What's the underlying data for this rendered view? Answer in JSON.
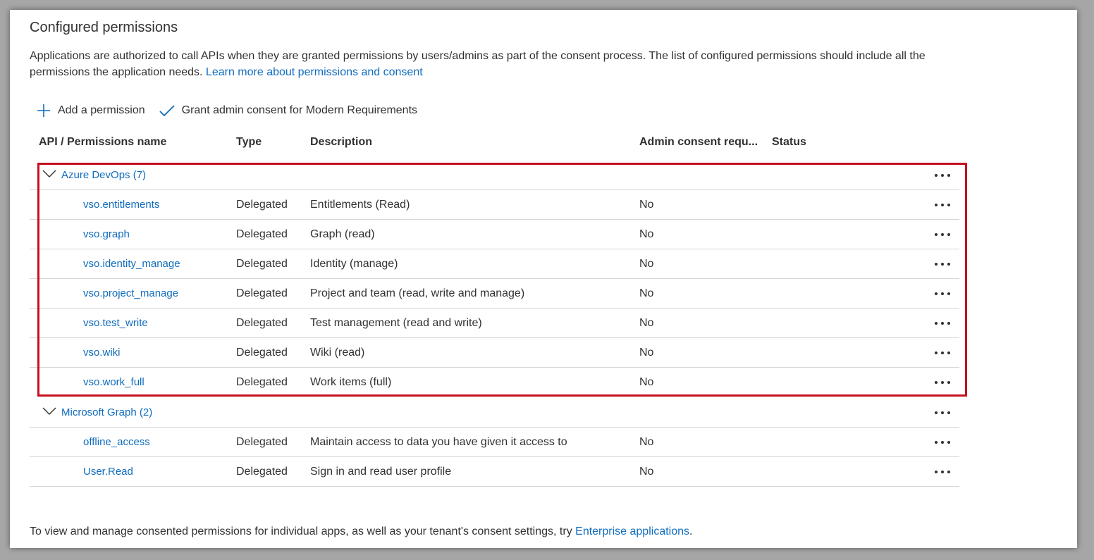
{
  "page": {
    "heading": "Configured permissions",
    "description": "Applications are authorized to call APIs when they are granted permissions by users/admins as part of the consent process. The list of configured permissions should include all the permissions the application needs.",
    "learn_more_link": "Learn more about permissions and consent"
  },
  "toolbar": {
    "add_permission": "Add a permission",
    "grant_consent": "Grant admin consent for Modern Requirements"
  },
  "columns": {
    "api_name": "API / Permissions name",
    "type": "Type",
    "description": "Description",
    "admin_consent": "Admin consent requ...",
    "status": "Status"
  },
  "groups": [
    {
      "label": "Azure DevOps (7)",
      "highlighted": true,
      "permissions": [
        {
          "name": "vso.entitlements",
          "type": "Delegated",
          "description": "Entitlements (Read)",
          "admin": "No"
        },
        {
          "name": "vso.graph",
          "type": "Delegated",
          "description": "Graph (read)",
          "admin": "No"
        },
        {
          "name": "vso.identity_manage",
          "type": "Delegated",
          "description": "Identity (manage)",
          "admin": "No"
        },
        {
          "name": "vso.project_manage",
          "type": "Delegated",
          "description": "Project and team (read, write and manage)",
          "admin": "No"
        },
        {
          "name": "vso.test_write",
          "type": "Delegated",
          "description": "Test management (read and write)",
          "admin": "No"
        },
        {
          "name": "vso.wiki",
          "type": "Delegated",
          "description": "Wiki (read)",
          "admin": "No"
        },
        {
          "name": "vso.work_full",
          "type": "Delegated",
          "description": "Work items (full)",
          "admin": "No"
        }
      ]
    },
    {
      "label": "Microsoft Graph (2)",
      "highlighted": false,
      "permissions": [
        {
          "name": "offline_access",
          "type": "Delegated",
          "description": "Maintain access to data you have given it access to",
          "admin": "No"
        },
        {
          "name": "User.Read",
          "type": "Delegated",
          "description": "Sign in and read user profile",
          "admin": "No"
        }
      ]
    }
  ],
  "footer": {
    "text": "To view and manage consented permissions for individual apps, as well as your tenant's consent settings, try",
    "link": "Enterprise applications",
    "suffix": "."
  },
  "colors": {
    "link": "#0f6cbd",
    "highlight_border": "#c50f1f",
    "text": "#323130"
  },
  "icons": {
    "add": "plus-icon",
    "grant": "checkmark-icon",
    "expand": "chevron-down-icon",
    "more": "more-options-icon"
  }
}
